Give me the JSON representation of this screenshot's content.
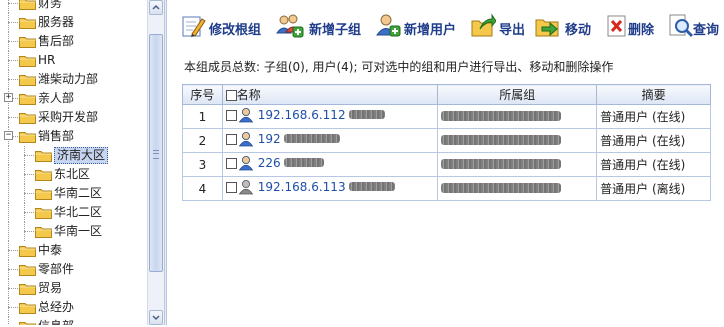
{
  "tree": {
    "items": [
      {
        "label": "财务",
        "level": 1,
        "expander": "",
        "selected": false
      },
      {
        "label": "服务器",
        "level": 1,
        "expander": "",
        "selected": false
      },
      {
        "label": "售后部",
        "level": 1,
        "expander": "",
        "selected": false
      },
      {
        "label": "HR",
        "level": 1,
        "expander": "",
        "selected": false
      },
      {
        "label": "潍柴动力部",
        "level": 1,
        "expander": "",
        "selected": false
      },
      {
        "label": "亲人部",
        "level": 1,
        "expander": "+",
        "selected": false
      },
      {
        "label": "采购开发部",
        "level": 1,
        "expander": "",
        "selected": false
      },
      {
        "label": "销售部",
        "level": 1,
        "expander": "−",
        "selected": false
      },
      {
        "label": "济南大区",
        "level": 2,
        "expander": "",
        "selected": true
      },
      {
        "label": "东北区",
        "level": 2,
        "expander": "",
        "selected": false
      },
      {
        "label": "华南二区",
        "level": 2,
        "expander": "",
        "selected": false
      },
      {
        "label": "华北二区",
        "level": 2,
        "expander": "",
        "selected": false
      },
      {
        "label": "华南一区",
        "level": 2,
        "expander": "",
        "selected": false
      },
      {
        "label": "中泰",
        "level": 1,
        "expander": "",
        "selected": false
      },
      {
        "label": "零部件",
        "level": 1,
        "expander": "",
        "selected": false
      },
      {
        "label": "贸易",
        "level": 1,
        "expander": "",
        "selected": false
      },
      {
        "label": "总经办",
        "level": 1,
        "expander": "",
        "selected": false
      },
      {
        "label": "信息部",
        "level": 1,
        "expander": "",
        "selected": false
      }
    ]
  },
  "toolbar": {
    "buttons": [
      {
        "label": "修改根组",
        "icon": "edit-group-icon"
      },
      {
        "label": "新增子组",
        "icon": "add-subgroup-icon"
      },
      {
        "label": "新增用户",
        "icon": "add-user-icon"
      },
      {
        "label": "导出",
        "icon": "export-icon"
      },
      {
        "label": "移动",
        "icon": "move-icon"
      },
      {
        "label": "删除",
        "icon": "delete-icon"
      },
      {
        "label": "查询",
        "icon": "search-icon"
      }
    ]
  },
  "info": {
    "text": "本组成员总数: 子组(0), 用户(4); 可对选中的组和用户进行导出、移动和删除操作"
  },
  "table": {
    "headers": {
      "no": "序号",
      "name": "名称",
      "group": "所属组",
      "summary": "摘要"
    },
    "rows": [
      {
        "no": "1",
        "name": "192.168.6.112",
        "summary": "普通用户 (在线)",
        "online": true
      },
      {
        "no": "2",
        "name": "192",
        "summary": "普通用户 (在线)",
        "online": true
      },
      {
        "no": "3",
        "name": "226",
        "summary": "普通用户 (在线)",
        "online": true
      },
      {
        "no": "4",
        "name": "192.168.6.113",
        "summary": "普通用户 (离线)",
        "online": false
      }
    ]
  },
  "colors": {
    "accent": "#1f3d8a",
    "link": "#1f4fa8",
    "selection": "#c6d6f0",
    "folder": "#f3c84b",
    "header_border": "#a6b8d8"
  }
}
